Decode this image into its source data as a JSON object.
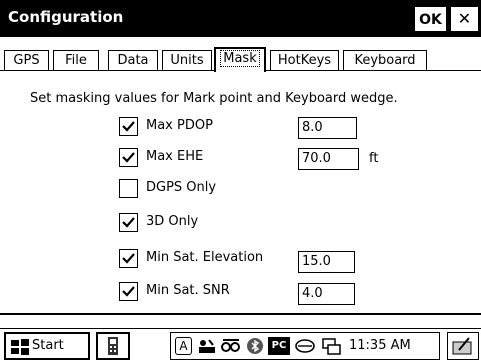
{
  "window": {
    "title": "Configuration",
    "ok_label": "OK",
    "close_glyph": "✕"
  },
  "tabs": [
    {
      "label": "GPS",
      "active": false
    },
    {
      "label": "File",
      "active": false
    },
    {
      "label": "Data",
      "active": false
    },
    {
      "label": "Units",
      "active": false
    },
    {
      "label": "Mask",
      "active": true
    },
    {
      "label": "HotKeys",
      "active": false
    },
    {
      "label": "Keyboard",
      "active": false
    }
  ],
  "mask": {
    "description": "Set masking values for Mark point and Keyboard wedge.",
    "options": [
      {
        "label": "Max PDOP",
        "checked": true,
        "value": "8.0",
        "unit": ""
      },
      {
        "label": "Max EHE",
        "checked": true,
        "value": "70.0",
        "unit": "ft"
      },
      {
        "label": "DGPS Only",
        "checked": false,
        "value": null,
        "unit": ""
      },
      {
        "label": "3D Only",
        "checked": true,
        "value": null,
        "unit": ""
      },
      {
        "label": "Min Sat. Elevation",
        "checked": true,
        "value": "15.0",
        "unit": ""
      },
      {
        "label": "Min Sat. SNR",
        "checked": true,
        "value": "4.0",
        "unit": ""
      }
    ]
  },
  "taskbar": {
    "start_label": "Start",
    "clock": "11:35 AM",
    "tray_icons": [
      "a-icon",
      "connectivity-icon",
      "gps-satellite-icon",
      "bluetooth-icon",
      "pc-icon",
      "sync-icon",
      "network-icon"
    ],
    "tray_text": {
      "a": "A",
      "pc": "PC"
    }
  }
}
